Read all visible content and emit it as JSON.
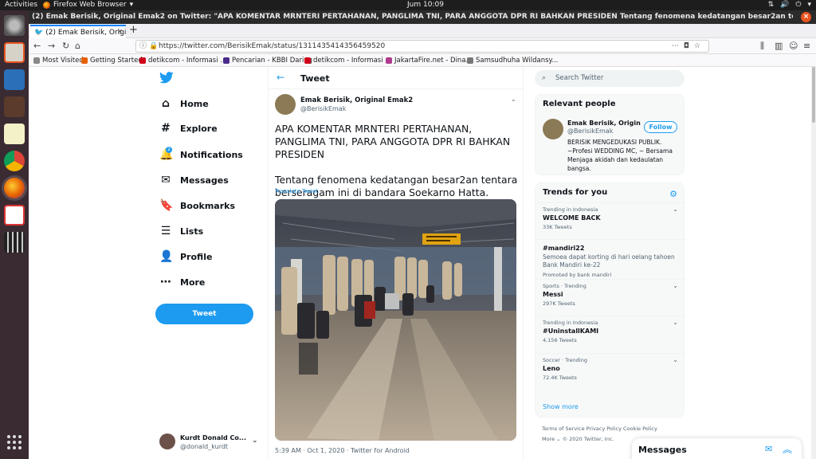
{
  "os": {
    "activities": "Activities",
    "app_name": "Firefox Web Browser",
    "clock": "Jum 10:09"
  },
  "window": {
    "title": "(2) Emak Berisik, Original Emak2 on Twitter: \"APA KOMENTAR MRNTERI PERTAHANAN, PANGLIMA TNI, PARA ANGGOTA DPR RI BAHKAN PRESIDEN Tentang fenomena kedatangan besar2an tentara berseragam ini di bandara Soekarno Hatta. https://..."
  },
  "browser": {
    "tab_title": "(2) Emak Berisik, Origina",
    "url": "https://twitter.com/BerisikEmak/status/1311435414356459520",
    "bookmarks": [
      {
        "label": "Most Visited",
        "color": "#888888"
      },
      {
        "label": "Getting Started",
        "color": "#e66000"
      },
      {
        "label": "detikcom - Informasi ...",
        "color": "#d0021b"
      },
      {
        "label": "Pencarian - KBBI Daring",
        "color": "#4a2b8a"
      },
      {
        "label": "detikcom - Informasi ...",
        "color": "#d0021b"
      },
      {
        "label": "JakartaFire.net - Dina...",
        "color": "#b03a8e"
      },
      {
        "label": "Samsudhuha Wildansy...",
        "color": "#777777"
      }
    ]
  },
  "twitter": {
    "nav": [
      {
        "label": "Home",
        "icon": "home-icon",
        "glyph": "⌂"
      },
      {
        "label": "Explore",
        "icon": "hashtag-icon",
        "glyph": "#"
      },
      {
        "label": "Notifications",
        "icon": "bell-icon",
        "glyph": "🔔"
      },
      {
        "label": "Messages",
        "icon": "mail-icon",
        "glyph": "✉"
      },
      {
        "label": "Bookmarks",
        "icon": "bookmark-icon",
        "glyph": "🔖"
      },
      {
        "label": "Lists",
        "icon": "list-icon",
        "glyph": "☰"
      },
      {
        "label": "Profile",
        "icon": "person-icon",
        "glyph": "👤"
      },
      {
        "label": "More",
        "icon": "more-icon",
        "glyph": "⋯"
      }
    ],
    "notif_badge": "2",
    "tweet_button": "Tweet",
    "account": {
      "name": "Kurdt Donald Co...",
      "handle": "@donald_kurdt"
    },
    "header_title": "Tweet",
    "tweet": {
      "author": "Emak Berisik, Original Emak2",
      "handle": "@BerisikEmak",
      "text_1": "APA KOMENTAR MRNTERI PERTAHANAN, PANGLIMA TNI, PARA ANGGOTA DPR RI BAHKAN PRESIDEN",
      "text_2": "Tentang fenomena kedatangan besar2an tentara berseragam ini di bandara Soekarno Hatta.",
      "translate": "Translate Tweet",
      "meta": "5:39 AM · Oct 1, 2020 · Twitter for Android"
    },
    "search_placeholder": "Search Twitter",
    "relevant": {
      "heading": "Relevant people",
      "name": "Emak Berisik, Origina...",
      "handle": "@BerisikEmak",
      "follow": "Follow",
      "bio": "BERISIK MENGEDUKASI PUBLIK. ~Profesi WEDDING MC, ~ Bersama Menjaga akidah dan kedaulatan bangsa."
    },
    "trends_heading": "Trends for you",
    "trends": [
      {
        "ctx": "Trending in Indonesia",
        "name": "WELCOME BACK",
        "desc": "",
        "count": "33K Tweets",
        "more": true
      },
      {
        "ctx": "",
        "name": "#mandiri22",
        "desc": "Semoea dapat korting di hari oelang tahoen Bank Mandiri ke-22",
        "count": "Promoted by bank mandiri",
        "more": false
      },
      {
        "ctx": "Sports · Trending",
        "name": "Messi",
        "desc": "",
        "count": "297K Tweets",
        "more": true
      },
      {
        "ctx": "Trending in Indonesia",
        "name": "#UninstallKAMI",
        "desc": "",
        "count": "4,156 Tweets",
        "more": true
      },
      {
        "ctx": "Soccer · Trending",
        "name": "Leno",
        "desc": "",
        "count": "72.4K Tweets",
        "more": true
      }
    ],
    "show_more": "Show more",
    "footer_line1": "Terms of Service   Privacy Policy   Cookie Policy",
    "footer_line2": "More ⌄   © 2020 Twitter, Inc.",
    "messages_drawer": "Messages"
  }
}
